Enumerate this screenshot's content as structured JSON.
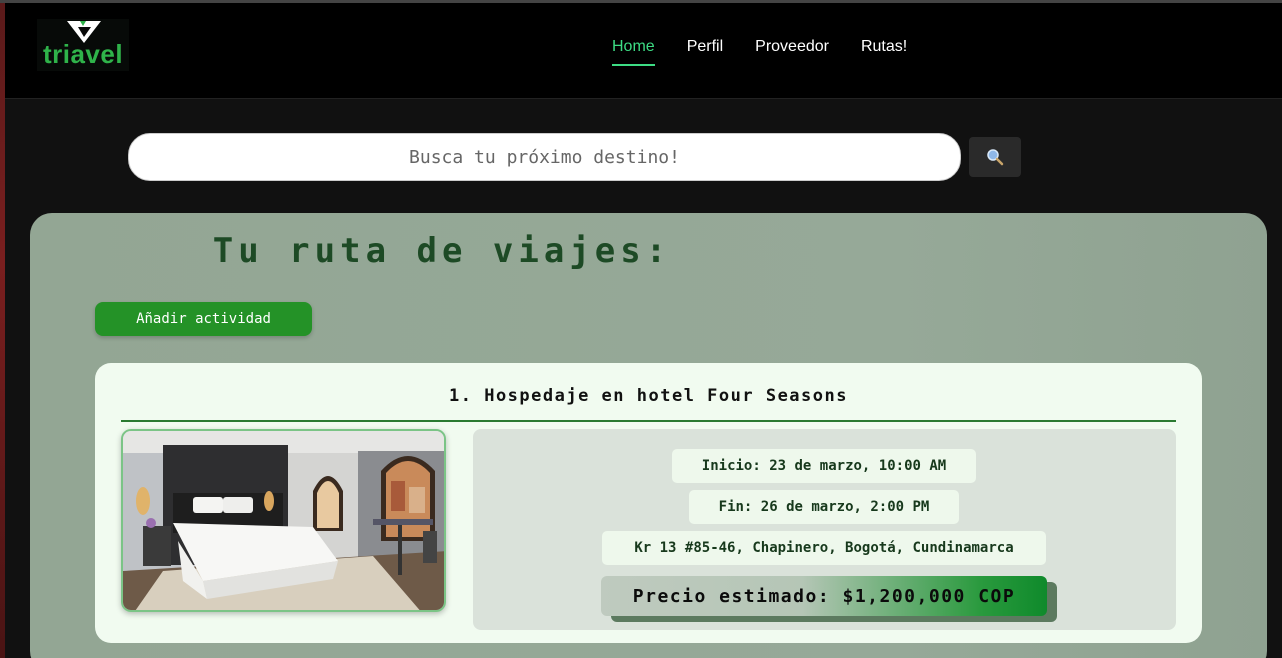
{
  "header": {
    "logo_text": "triavel",
    "nav": [
      {
        "label": "Home",
        "active": true
      },
      {
        "label": "Perfil"
      },
      {
        "label": "Proveedor"
      },
      {
        "label": "Rutas!"
      }
    ]
  },
  "search": {
    "placeholder": "Busca tu próximo destino!",
    "button_icon": "search-icon"
  },
  "route": {
    "title": "Tu ruta de viajes:",
    "add_button": "Añadir actividad",
    "activities": [
      {
        "title": "1. Hospedaje en hotel Four Seasons",
        "image": "hotel-room-photo",
        "inicio": "Inicio: 23 de marzo, 10:00 AM",
        "fin": "Fin: 26 de marzo, 2:00 PM",
        "address": "Kr 13 #85-46, Chapinero, Bogotá, Cundinamarca",
        "price": "Precio estimado: $1,200,000 COP"
      }
    ]
  },
  "colors": {
    "accent": "#3ddc84",
    "brand_green": "#249227",
    "panel": "#93a694",
    "title_green": "#1d4a25"
  }
}
